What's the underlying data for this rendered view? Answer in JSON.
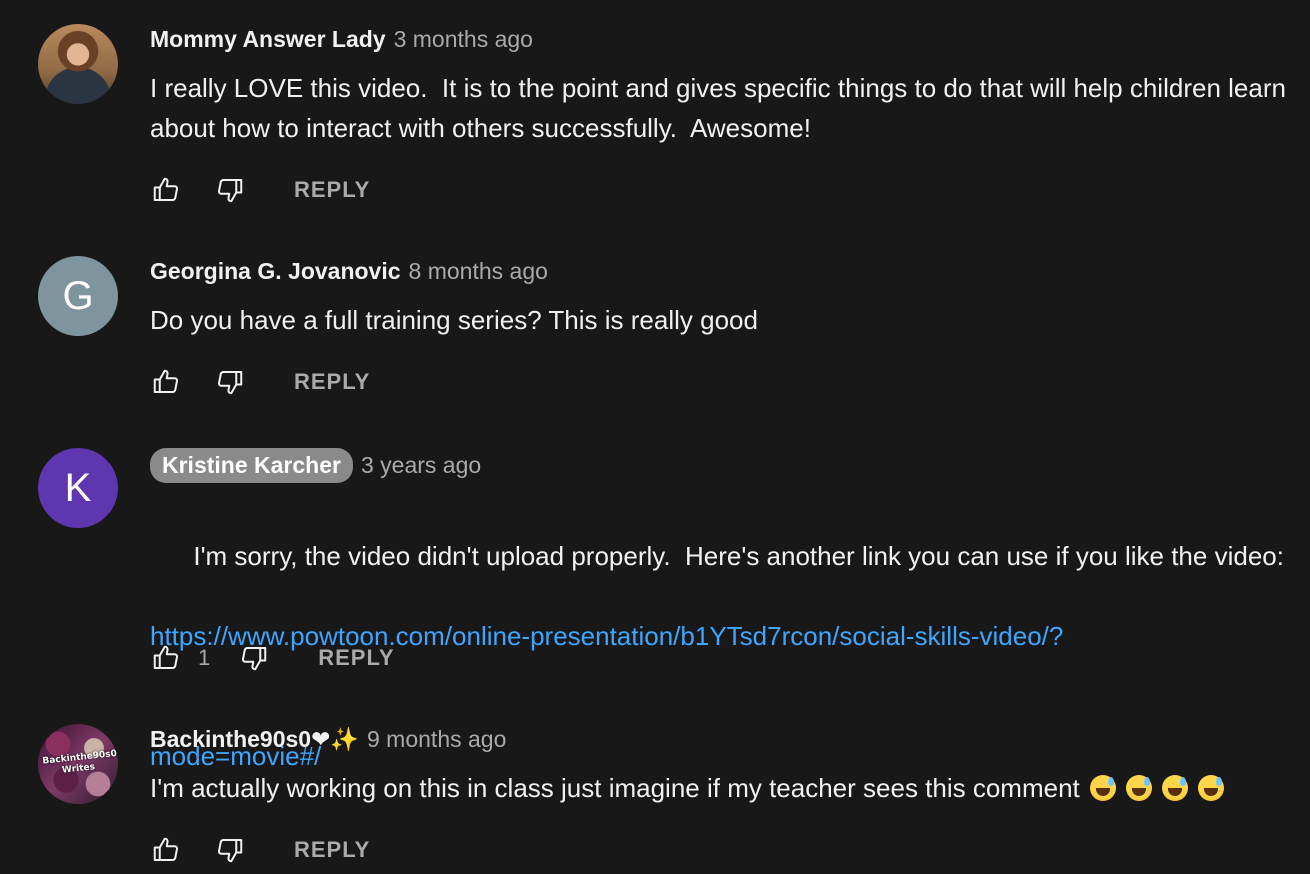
{
  "comments": [
    {
      "author": "Mommy Answer Lady",
      "timestamp": "3 months ago",
      "text": "I really LOVE this video.  It is to the point and gives specific things to do that will help children learn about how to interact with others successfully.  Awesome!",
      "avatar": "photo",
      "likes": "",
      "reply_label": "REPLY"
    },
    {
      "author": "Georgina G. Jovanovic",
      "timestamp": "8 months ago",
      "text": "Do you have a full training series? This is really good",
      "avatar_letter": "G",
      "avatar_color": "#7e959d",
      "likes": "",
      "reply_label": "REPLY"
    },
    {
      "author": "Kristine Karcher",
      "author_is_creator": true,
      "timestamp": "3 years ago",
      "text": "I'm sorry, the video didn't upload properly.  Here's another link you can use if you like the video:",
      "link": "https://www.powtoon.com/online-presentation/b1YTsd7rcon/social-skills-video/?mode=movie#/",
      "link_line1": "https://www.powtoon.com/online-presentation/b1YTsd7rcon/social-skills-video/?",
      "link_line2": "mode=movie#/",
      "avatar_letter": "K",
      "avatar_color": "#5e36b0",
      "likes": "1",
      "reply_label": "REPLY"
    },
    {
      "author": "Backinthe90s0❤✨",
      "timestamp": "9 months ago",
      "text": "I'm actually working on this in class just imagine if my teacher sees this comment",
      "emoji_count": 4,
      "emoji": "sweat-smile",
      "avatar": "photo-collage",
      "avatar_text": "Backinthe90s0 Writes",
      "likes": "",
      "reply_label": "REPLY"
    }
  ],
  "colors": {
    "background": "#181818",
    "text": "#f1f1f1",
    "secondary_text": "#aaaaaa",
    "link": "#3ea6ff",
    "creator_badge": "#8a8a8a"
  }
}
